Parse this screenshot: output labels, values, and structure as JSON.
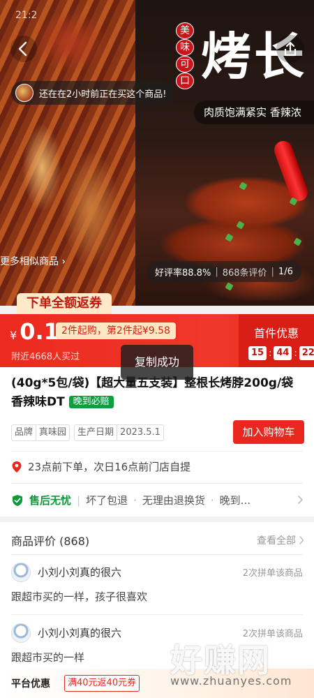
{
  "status_bar": {
    "time": "21:2"
  },
  "hero": {
    "seal_chars": [
      "美",
      "味",
      "可",
      "口"
    ],
    "big_title": "烤长",
    "slogan": "肉质饱满紧实 香辣浓",
    "buying_notice": "还在在2小时前正在买这个商品!",
    "similar_link": "更多相似商品",
    "rating_label": "好评率88.8%",
    "review_count_label": "868条评价",
    "page_indicator": "1/6"
  },
  "promo": {
    "refund_tag": "下单全额返券",
    "currency": "¥",
    "price": "0.1",
    "promo_chip": "2件起购，第2件起¥9.58",
    "nearby_buyers": "附近4668人买过",
    "first_deal_label": "首件优惠",
    "countdown": [
      "15",
      "44",
      "22"
    ]
  },
  "toast": {
    "text": "复制成功"
  },
  "product": {
    "title": "(40g*5包/袋)【超大量五支装】整根长烤脖200g/袋香辣味DT",
    "late_badge": "晚到必赔",
    "attributes": [
      {
        "key": "品牌",
        "value": "真味园"
      },
      {
        "key": "生产日期",
        "value": "2023.5.1"
      }
    ],
    "add_to_cart": "加入购物车",
    "pickup_text": "23点前下单，次日16点前门店自提",
    "after_sale": {
      "title": "售后无忧",
      "items": [
        "坏了包退",
        "无理由退换货",
        "晚到..."
      ]
    }
  },
  "reviews": {
    "heading": "商品评价 (868)",
    "view_all": "查看全部",
    "items": [
      {
        "user": "小刘小刘真的很六",
        "group_count": "2次拼单该商品",
        "text": "跟超市买的一样，孩子很喜欢"
      },
      {
        "user": "小刘小刘真的很六",
        "group_count": "2次拼单该商品",
        "text": "跟超市买的一样"
      }
    ]
  },
  "platform": {
    "label": "平台优惠",
    "coupon": "满40元返40元券"
  },
  "watermark": {
    "main": "好赚网",
    "sub": "www.zhuanyes.com"
  },
  "colors": {
    "accent_red": "#e8281f",
    "deep_red": "#d81e15",
    "green_badge": "#0aa03c",
    "cream": "#ffe7c4"
  }
}
